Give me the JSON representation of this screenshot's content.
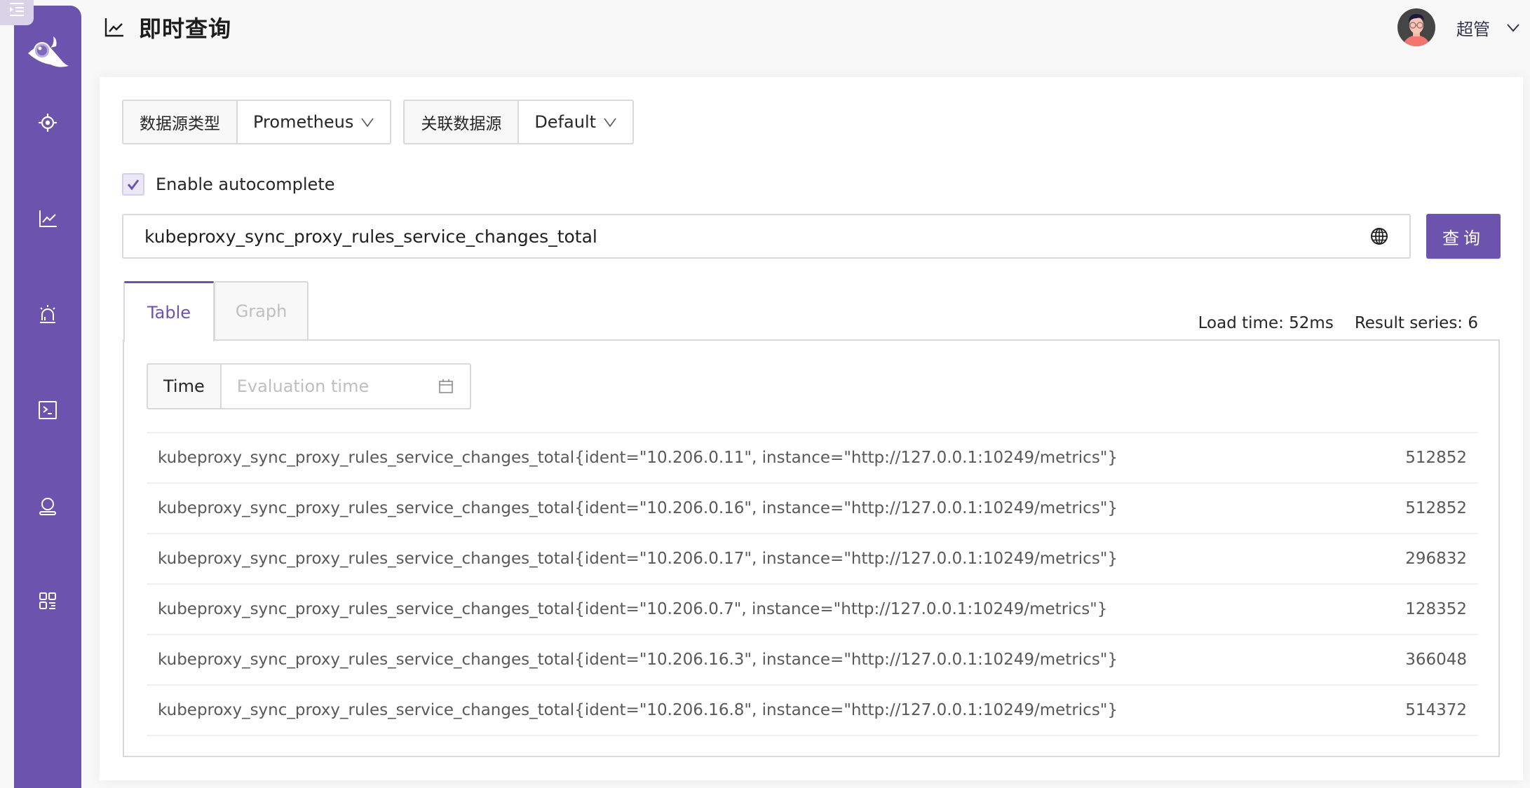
{
  "header": {
    "title": "即时查询",
    "title_icon": "line-chart-icon",
    "user_name": "超管"
  },
  "sidebar": {
    "items": [
      {
        "name": "target-icon"
      },
      {
        "name": "line-chart-icon"
      },
      {
        "name": "alarm-icon"
      },
      {
        "name": "terminal-icon"
      },
      {
        "name": "user-icon"
      },
      {
        "name": "apps-icon"
      }
    ]
  },
  "datasource": {
    "type_label": "数据源类型",
    "type_value": "Prometheus",
    "source_label": "关联数据源",
    "source_value": "Default"
  },
  "autocomplete": {
    "label": "Enable autocomplete",
    "checked": true
  },
  "query": {
    "value": "kubeproxy_sync_proxy_rules_service_changes_total",
    "button_label": "查询"
  },
  "tabs": [
    {
      "label": "Table",
      "active": true
    },
    {
      "label": "Graph",
      "active": false
    }
  ],
  "stats": {
    "load_time": "Load time: 52ms",
    "result_series": "Result series: 6"
  },
  "time": {
    "label": "Time",
    "placeholder": "Evaluation time"
  },
  "results": [
    {
      "metric": "kubeproxy_sync_proxy_rules_service_changes_total{ident=\"10.206.0.11\", instance=\"http://127.0.0.1:10249/metrics\"}",
      "value": "512852"
    },
    {
      "metric": "kubeproxy_sync_proxy_rules_service_changes_total{ident=\"10.206.0.16\", instance=\"http://127.0.0.1:10249/metrics\"}",
      "value": "512852"
    },
    {
      "metric": "kubeproxy_sync_proxy_rules_service_changes_total{ident=\"10.206.0.17\", instance=\"http://127.0.0.1:10249/metrics\"}",
      "value": "296832"
    },
    {
      "metric": "kubeproxy_sync_proxy_rules_service_changes_total{ident=\"10.206.0.7\", instance=\"http://127.0.0.1:10249/metrics\"}",
      "value": "128352"
    },
    {
      "metric": "kubeproxy_sync_proxy_rules_service_changes_total{ident=\"10.206.16.3\", instance=\"http://127.0.0.1:10249/metrics\"}",
      "value": "366048"
    },
    {
      "metric": "kubeproxy_sync_proxy_rules_service_changes_total{ident=\"10.206.16.8\", instance=\"http://127.0.0.1:10249/metrics\"}",
      "value": "514372"
    }
  ],
  "colors": {
    "brand": "#6c53ae",
    "background": "#f8f8f8",
    "border": "#d9d9d9"
  }
}
